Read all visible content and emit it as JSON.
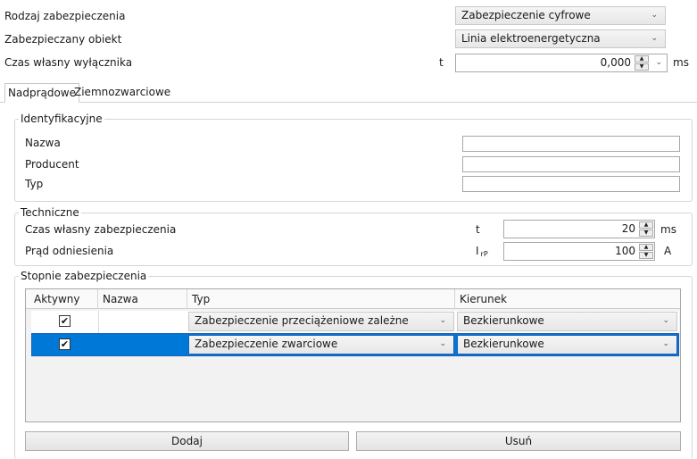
{
  "header": {
    "protection_type_label": "Rodzaj zabezpieczenia",
    "protection_type_value": "Zabezpieczenie cyfrowe",
    "protected_object_label": "Zabezpieczany obiekt",
    "protected_object_value": "Linia elektroenergetyczna",
    "breaker_time_label": "Czas własny wyłącznika",
    "breaker_time_symbol": "t",
    "breaker_time_value": "0,000",
    "breaker_time_unit": "ms"
  },
  "tabs": [
    {
      "label": "Nadprądowe",
      "active": true
    },
    {
      "label": "Ziemnozwarciowe",
      "active": false
    }
  ],
  "identification": {
    "title": "Identyfikacyjne",
    "name_label": "Nazwa",
    "name_value": "",
    "producer_label": "Producent",
    "producer_value": "",
    "type_label": "Typ",
    "type_value": ""
  },
  "technical": {
    "title": "Techniczne",
    "own_time_label": "Czas własny zabezpieczenia",
    "own_time_symbol": "t",
    "own_time_value": "20",
    "own_time_unit": "ms",
    "ref_current_label": "Prąd odniesienia",
    "ref_current_symbol": "I",
    "ref_current_subscript": "rP",
    "ref_current_value": "100",
    "ref_current_unit": "A"
  },
  "stages": {
    "title": "Stopnie zabezpieczenia",
    "columns": [
      "Aktywny",
      "Nazwa",
      "Typ",
      "Kierunek"
    ],
    "rows": [
      {
        "active": true,
        "name": "",
        "type": "Zabezpieczenie przeciążeniowe zależne",
        "direction": "Bezkierunkowe",
        "selected": false
      },
      {
        "active": true,
        "name": "",
        "type": "Zabezpieczenie zwarciowe",
        "direction": "Bezkierunkowe",
        "selected": true
      }
    ]
  },
  "buttons": {
    "add_label": "Dodaj",
    "remove_label": "Usuń"
  },
  "colors": {
    "selection": "#0078d7",
    "accent_border": "#1a5fb4"
  },
  "icons": {
    "chevron": "chevron-down-icon",
    "spin_up": "arrow-up-icon",
    "spin_down": "arrow-down-icon",
    "check": "checkmark-icon"
  }
}
